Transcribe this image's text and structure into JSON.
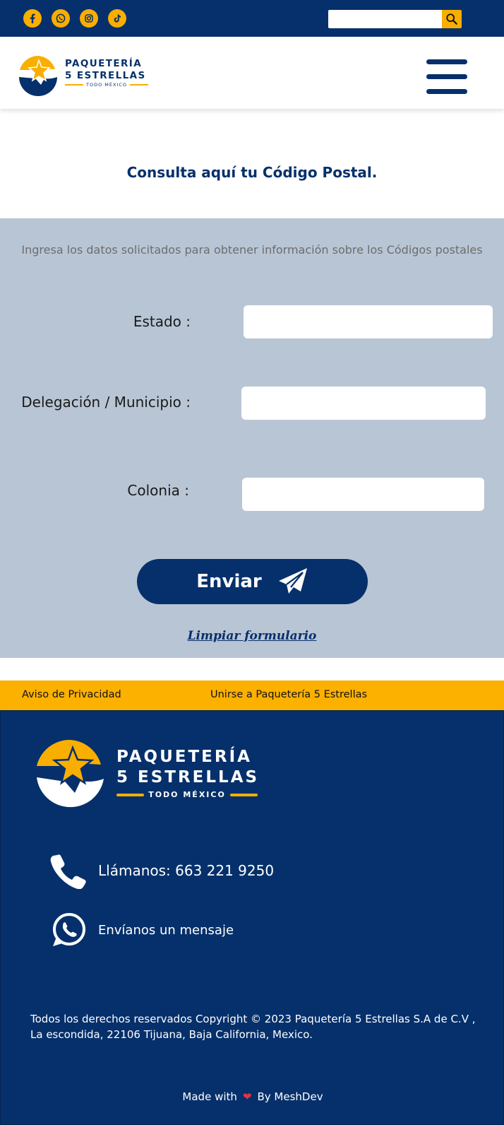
{
  "topbar": {
    "socials": [
      {
        "icon": "facebook-icon"
      },
      {
        "icon": "whatsapp-icon"
      },
      {
        "icon": "instagram-icon"
      },
      {
        "icon": "tiktok-icon"
      }
    ],
    "search": {
      "placeholder": "",
      "value": "",
      "icon": "search-icon"
    }
  },
  "header": {
    "brand_line1": "PAQUETERÍA",
    "brand_line2": "5 ESTRELLAS",
    "brand_line3": "TODO MÉXICO",
    "menu_icon": "hamburger-menu-icon"
  },
  "hero": {
    "title": "Consulta aquí tu Código Postal."
  },
  "form": {
    "intro": "Ingresa los datos solicitados para obtener información sobre los Códigos postales",
    "fields": [
      {
        "label": "Estado :",
        "value": ""
      },
      {
        "label": "Delegación / Municipio :",
        "value": ""
      },
      {
        "label": "Colonia :",
        "value": ""
      }
    ],
    "submit_label": "Enviar",
    "submit_icon": "paper-plane-icon",
    "clear_label": "Limpiar formulario"
  },
  "nav": {
    "privacy": "Aviso de Privacidad",
    "join": "Unirse a Paquetería 5 Estrellas"
  },
  "footer": {
    "brand_line1": "PAQUETERÍA",
    "brand_line2": "5 ESTRELLAS",
    "brand_line3": "TODO MÉXICO",
    "call_label": "Llámanos: 663 221 9250",
    "message_label": "Envíanos un mensaje",
    "copyright_line1": "Todos los derechos reservados Copyright © 2023 Paquetería 5  Estrellas S.A de C.V ,",
    "copyright_line2": "La escondida, 22106 Tijuana, Baja California, Mexico.",
    "made_with": "Made with",
    "by": "By MeshDev"
  },
  "colors": {
    "navy": "#06306b",
    "yellow": "#f9ae00",
    "panel": "#b8c5d5",
    "heart": "#e0344a"
  }
}
